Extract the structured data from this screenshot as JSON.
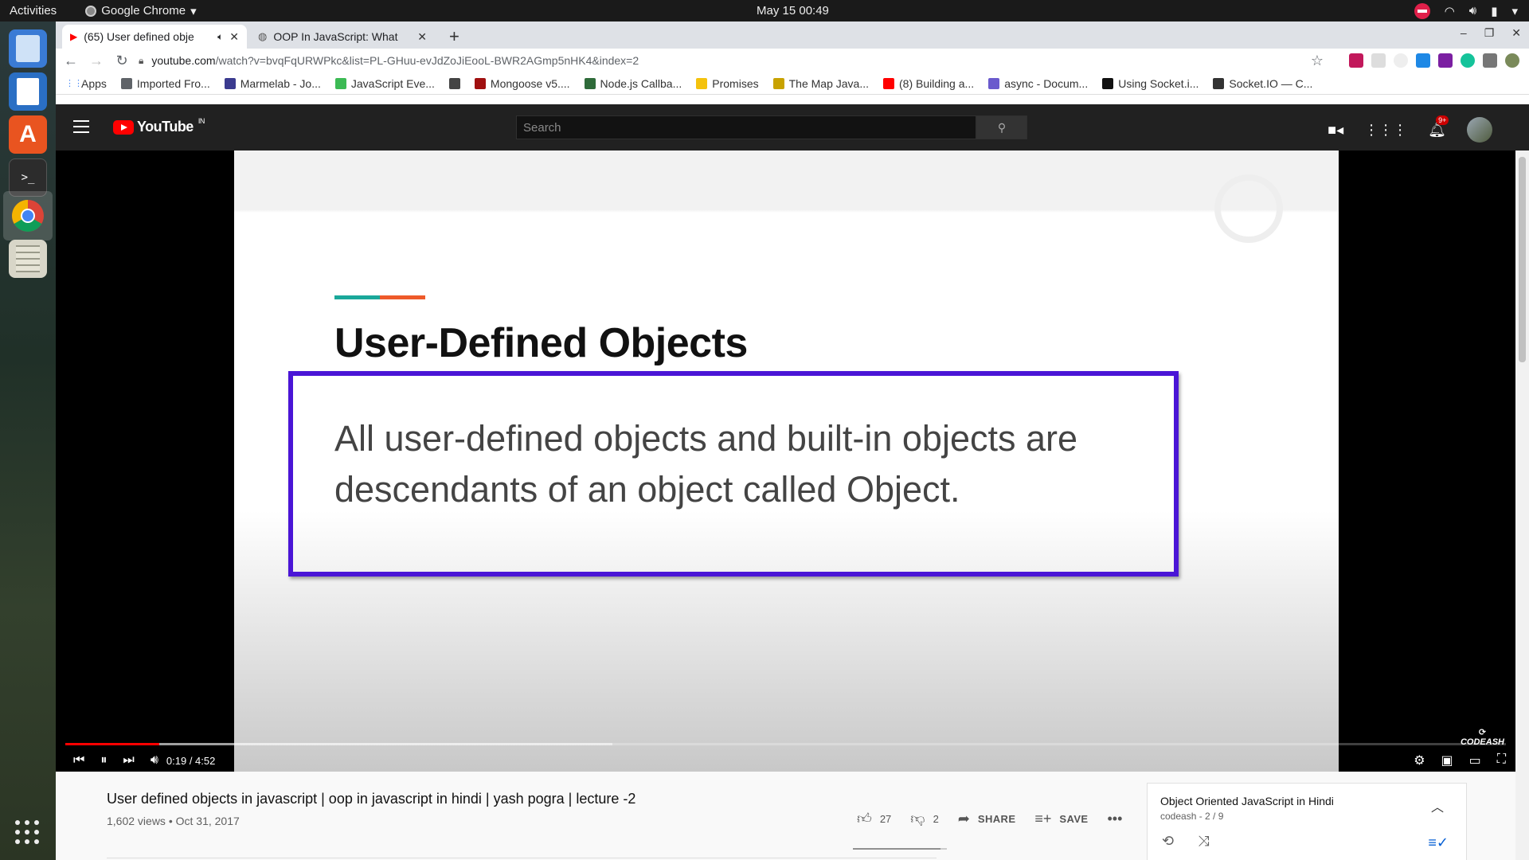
{
  "system": {
    "activities": "Activities",
    "app_name": "Google Chrome",
    "clock": "May 15  00:49"
  },
  "browser": {
    "tabs": [
      {
        "title": "(65) User defined obje",
        "active": true
      },
      {
        "title": "OOP In JavaScript: What",
        "active": false
      }
    ],
    "url_host": "youtube.com",
    "url_path": "/watch?v=bvqFqURWPkc&list=PL-GHuu-evJdZoJiEooL-BWR2AGmp5nHK4&index=2",
    "bookmarks": [
      {
        "label": "Apps",
        "color": "#4285f4"
      },
      {
        "label": "Imported Fro...",
        "color": "#5f6368"
      },
      {
        "label": "Marmelab - Jo...",
        "color": "#3b3b8f"
      },
      {
        "label": "JavaScript Eve...",
        "color": "#3cba54"
      },
      {
        "label": "",
        "color": "#444444"
      },
      {
        "label": "Mongoose v5....",
        "color": "#a01010"
      },
      {
        "label": "Node.js Callba...",
        "color": "#2f6b3a"
      },
      {
        "label": "Promises",
        "color": "#f4c20d"
      },
      {
        "label": "The Map Java...",
        "color": "#c8a200"
      },
      {
        "label": "(8) Building a...",
        "color": "#ff0000"
      },
      {
        "label": "async - Docum...",
        "color": "#6a5acd"
      },
      {
        "label": "Using Socket.i...",
        "color": "#111111"
      },
      {
        "label": "Socket.IO — C...",
        "color": "#333333"
      }
    ]
  },
  "youtube": {
    "logo_text": "YouTube",
    "logo_region": "IN",
    "search_placeholder": "Search",
    "notification_count": "9+",
    "slide": {
      "title": "User-Defined Objects",
      "body": "All user-defined objects and built-in objects are descendants of an object called Object.",
      "watermark": "CODEASH"
    },
    "player": {
      "time": "0:19 / 4:52",
      "played_fraction": 0.065,
      "buffered_fraction": 0.38
    },
    "video": {
      "title": "User defined objects in javascript | oop in javascript in hindi | yash pogra | lecture -2",
      "meta": "1,602 views • Oct 31, 2017",
      "likes": "27",
      "dislikes": "2",
      "share_label": "SHARE",
      "save_label": "SAVE",
      "like_ratio": 0.93
    },
    "playlist": {
      "title": "Object Oriented JavaScript in Hindi",
      "subtitle": "codeash - 2 / 9"
    }
  }
}
